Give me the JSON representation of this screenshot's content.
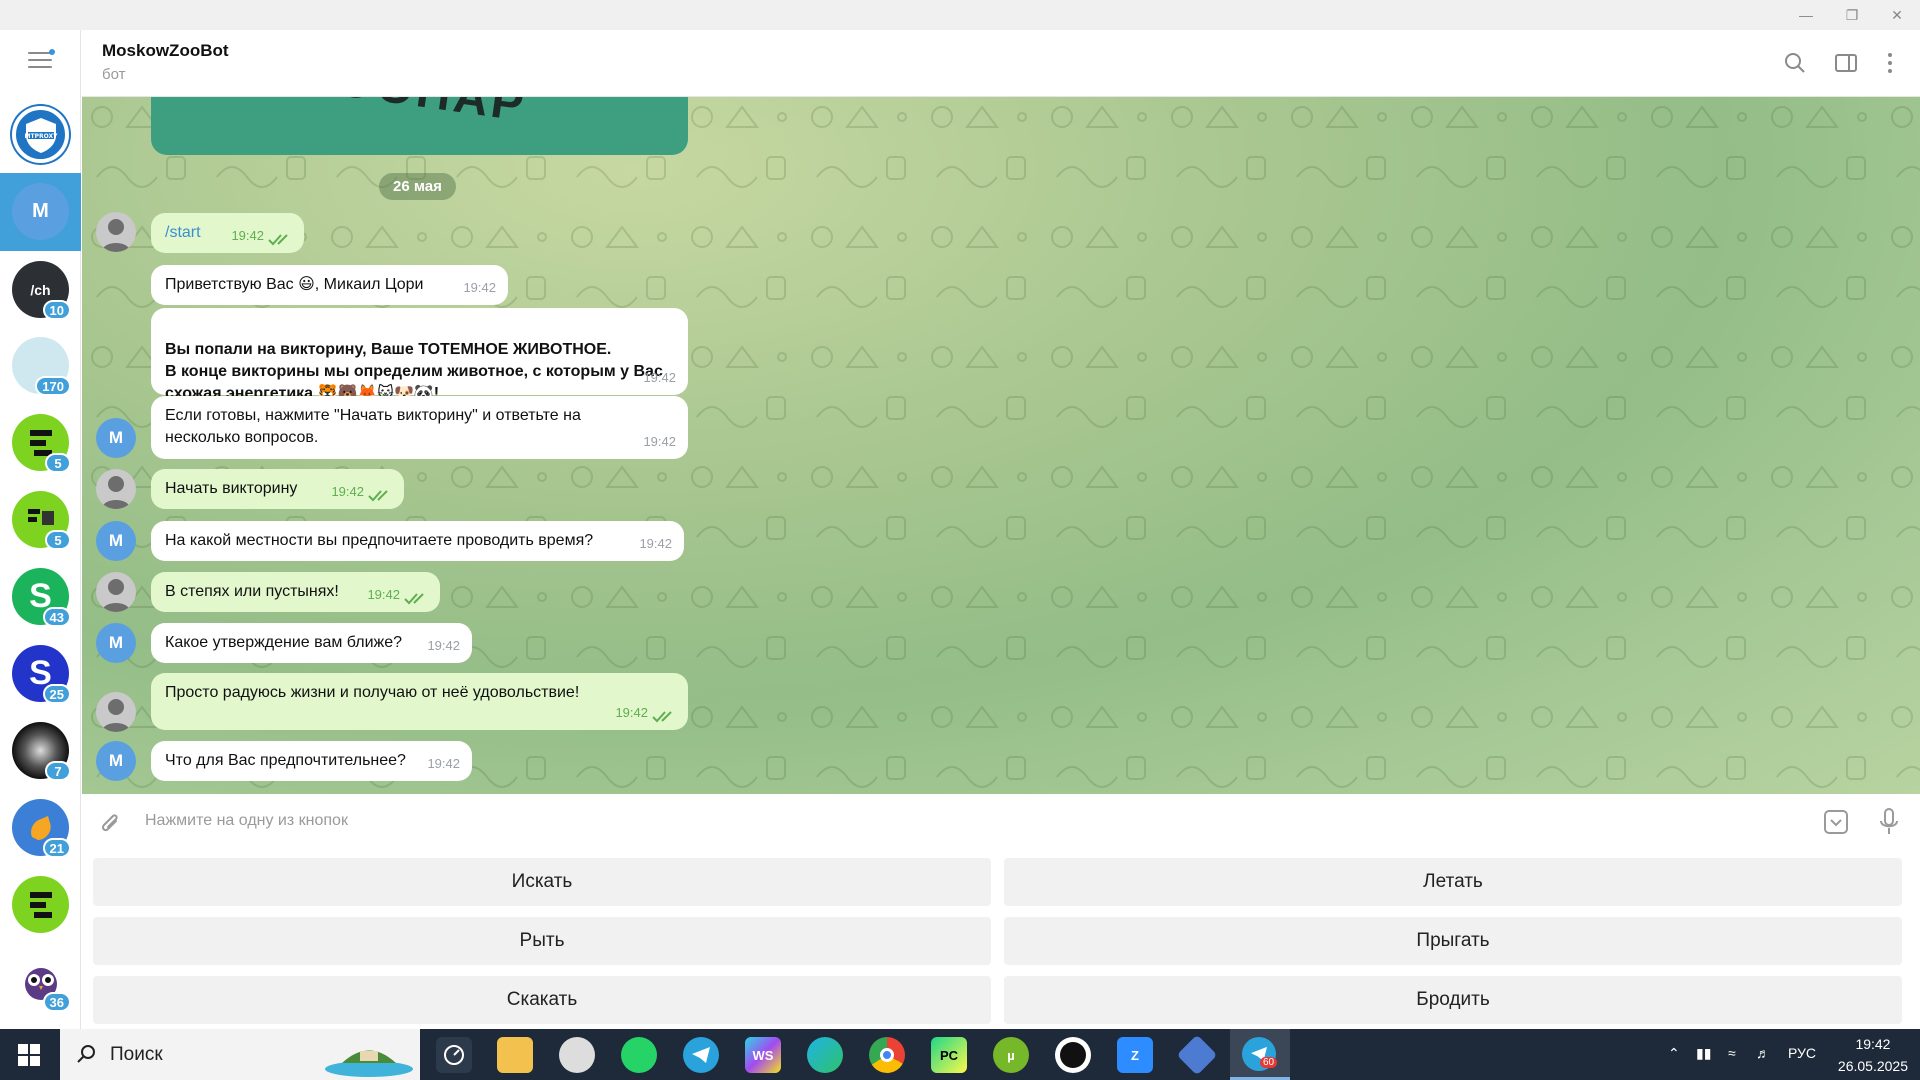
{
  "header": {
    "title": "MoskowZooBot",
    "subtitle": "бот"
  },
  "chat": {
    "banner_text": "ООПАР",
    "date": "26 мая",
    "messages": [
      {
        "dir": "out",
        "text": "/start",
        "time": "19:42"
      },
      {
        "dir": "in",
        "text": "Приветствую Вас 😃, Микаил Цори",
        "time": "19:42"
      },
      {
        "dir": "in",
        "text": "Вы попали на викторину, Ваше ТОТЕМНОЕ ЖИВОТНОЕ.\n В конце викторины мы определим животное, с которым у Вас схожая энергетика 🐯🐻🦊🐱🐶🐼!",
        "time": "19:42"
      },
      {
        "dir": "in",
        "text": "Если готовы, нажмите \"Начать викторину\" и ответьте на несколько вопросов.",
        "time": "19:42"
      },
      {
        "dir": "out",
        "text": "Начать викторину",
        "time": "19:42"
      },
      {
        "dir": "in",
        "text": "На какой местности вы предпочитаете проводить время?",
        "time": "19:42"
      },
      {
        "dir": "out",
        "text": "В степях или пустынях!",
        "time": "19:42"
      },
      {
        "dir": "in",
        "text": "Какое утверждение вам ближе?",
        "time": "19:42"
      },
      {
        "dir": "out",
        "text": "Просто радуюсь жизни и получаю от неё удовольствие!",
        "time": "19:42"
      },
      {
        "dir": "in",
        "text": "Что для Вас предпочтительнее?",
        "time": "19:42"
      }
    ]
  },
  "input": {
    "placeholder": "Нажмите на одну из кнопок"
  },
  "keyboard": {
    "buttons": [
      "Искать",
      "Летать",
      "Рыть",
      "Прыгать",
      "Скакать",
      "Бродить"
    ]
  },
  "sidebar": {
    "active_initial": "M",
    "chats": [
      {
        "icon": "mtproxy-icon",
        "label": "MTPROXY",
        "badge": ""
      },
      {
        "icon": "avatar-m",
        "label": "M",
        "badge": ""
      },
      {
        "icon": "code-icon",
        "label": "ch",
        "badge": "10"
      },
      {
        "icon": "channel-icon",
        "label": "",
        "badge": "170"
      },
      {
        "icon": "skillbox-icon",
        "label": "",
        "badge": "5"
      },
      {
        "icon": "skillbox-laptop-icon",
        "label": "",
        "badge": "5"
      },
      {
        "icon": "s-green-icon",
        "label": "",
        "badge": "43"
      },
      {
        "icon": "s-blue-icon",
        "label": "",
        "badge": "25"
      },
      {
        "icon": "galaxy-icon",
        "label": "",
        "badge": "7"
      },
      {
        "icon": "hand-icon",
        "label": "",
        "badge": "21"
      },
      {
        "icon": "skillbox-round-icon",
        "label": "",
        "badge": ""
      },
      {
        "icon": "owl-icon",
        "label": "",
        "badge": "36"
      }
    ]
  },
  "taskbar": {
    "search_label": "Поиск",
    "language": "РУС",
    "time": "19:42",
    "date": "26.05.2025",
    "telegram_badge": "60"
  },
  "colors": {
    "accent": "#419fd9",
    "outgoing": "#e2f7cc",
    "taskbar": "#1e2a3a"
  }
}
